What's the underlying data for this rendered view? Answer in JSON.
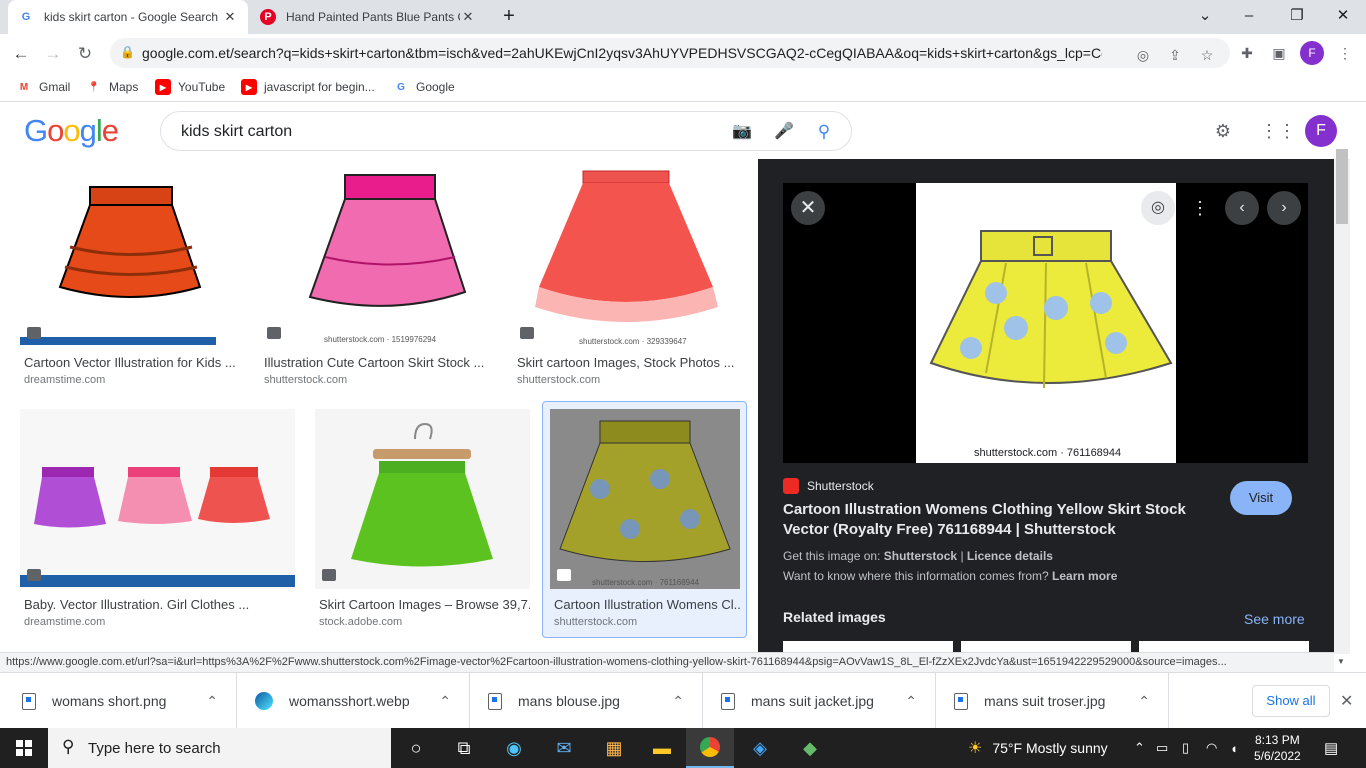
{
  "tabs": [
    {
      "title": "kids skirt carton - Google Search",
      "favicon": "google-icon",
      "active": true
    },
    {
      "title": "Hand Painted Pants Blue Pants Cl",
      "favicon": "pinterest-icon",
      "active": false
    }
  ],
  "address_bar": {
    "url": "google.com.et/search?q=kids+skirt+carton&tbm=isch&ved=2ahUKEwjCnI2yqsv3AhUYVPEDHSVSCGAQ2-cCegQIABAA&oq=kids+skirt+carton&gs_lcp=CgN..."
  },
  "profile_initial": "F",
  "bookmarks": [
    {
      "label": "Gmail",
      "icon": "gmail-icon"
    },
    {
      "label": "Maps",
      "icon": "maps-icon"
    },
    {
      "label": "YouTube",
      "icon": "youtube-icon"
    },
    {
      "label": "javascript for begin...",
      "icon": "youtube-icon"
    },
    {
      "label": "Google",
      "icon": "google-icon"
    }
  ],
  "search": {
    "query": "kids skirt carton",
    "logo": "Google"
  },
  "results": [
    {
      "caption": "Cartoon Vector Illustration for Kids ...",
      "source": "dreamstime.com",
      "watermark": "dreamstime.com",
      "color": "#d84315"
    },
    {
      "caption": "Illustration Cute Cartoon Skirt Stock ...",
      "source": "shutterstock.com",
      "watermark": "shutterstock.com · 1519976294",
      "color": "#e91e8c"
    },
    {
      "caption": "Skirt cartoon Images, Stock Photos ...",
      "source": "shutterstock.com",
      "watermark": "shutterstock.com · 329339647",
      "color": "#f4544e"
    },
    {
      "caption": "Baby. Vector Illustration. Girl Clothes ...",
      "source": "dreamstime.com",
      "watermark": "dreamstime.com",
      "color": "#b04fd6"
    },
    {
      "caption": "Skirt Cartoon Images – Browse 39,7...",
      "source": "stock.adobe.com",
      "watermark": "",
      "color": "#5cc21f"
    },
    {
      "caption": "Cartoon Illustration Womens Cl...",
      "source": "shutterstock.com",
      "watermark": "shutterstock.com · 761168944",
      "color": "#c9c62a"
    }
  ],
  "preview": {
    "image_watermark": "shutterstock.com · 761168944",
    "site": "Shutterstock",
    "title": "Cartoon Illustration Womens Clothing Yellow Skirt Stock Vector (Royalty Free) 761168944 | Shutterstock",
    "visit_label": "Visit",
    "get_image_prefix": "Get this image on:",
    "get_image_site": "Shutterstock",
    "separator": "|",
    "licence": "Licence details",
    "info_prefix": "Want to know where this information comes from?",
    "learn_more": "Learn more",
    "related": "Related images",
    "see_more": "See more"
  },
  "status_url": "https://www.google.com.et/url?sa=i&url=https%3A%2F%2Fwww.shutterstock.com%2Fimage-vector%2Fcartoon-illustration-womens-clothing-yellow-skirt-761168944&psig=AOvVaw1S_8L_El-fZzXEx2JvdcYa&ust=1651942229529000&source=images...",
  "downloads": [
    {
      "name": "womans short.png",
      "icon": "file-icon"
    },
    {
      "name": "womansshort.webp",
      "icon": "edge-icon"
    },
    {
      "name": "mans blouse.jpg",
      "icon": "file-icon"
    },
    {
      "name": "mans suit jacket.jpg",
      "icon": "file-icon"
    },
    {
      "name": "mans suit troser.jpg",
      "icon": "file-icon"
    }
  ],
  "show_all": "Show all",
  "taskbar": {
    "search_placeholder": "Type here to search",
    "weather": "75°F  Mostly sunny",
    "time": "8:13 PM",
    "date": "5/6/2022"
  },
  "colors": {
    "google_blue": "#4285f4",
    "google_red": "#ea4335",
    "google_yellow": "#fbbc05",
    "google_green": "#34a853",
    "visit": "#8ab4f8"
  }
}
